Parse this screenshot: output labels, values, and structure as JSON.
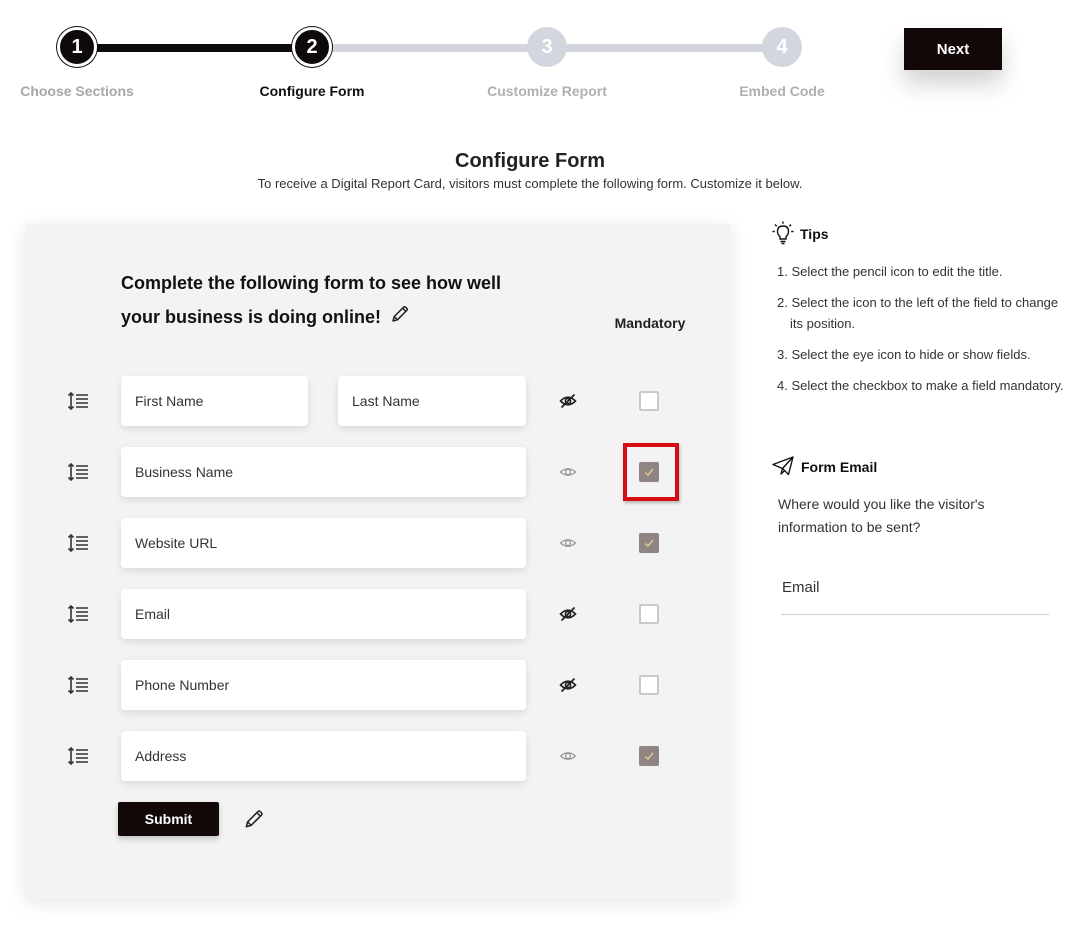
{
  "stepper": {
    "steps": [
      {
        "number": "1",
        "label": "Choose Sections"
      },
      {
        "number": "2",
        "label": "Configure Form"
      },
      {
        "number": "3",
        "label": "Customize Report"
      },
      {
        "number": "4",
        "label": "Embed Code"
      }
    ],
    "next_label": "Next"
  },
  "page": {
    "title": "Configure Form",
    "subtitle": "To receive a Digital Report Card, visitors must complete the following form. Customize it below."
  },
  "form": {
    "title": "Complete the following form to see how well your business is doing online!",
    "mandatory_label": "Mandatory",
    "fields": {
      "first_name": {
        "placeholder": "First Name"
      },
      "last_name": {
        "placeholder": "Last Name"
      },
      "business_name": {
        "placeholder": "Business Name"
      },
      "website_url": {
        "placeholder": "Website URL"
      },
      "email": {
        "placeholder": "Email"
      },
      "phone_number": {
        "placeholder": "Phone Number"
      },
      "address": {
        "placeholder": "Address"
      }
    },
    "rows_state": [
      {
        "visible": false,
        "mandatory": false
      },
      {
        "visible": true,
        "mandatory": true
      },
      {
        "visible": true,
        "mandatory": true
      },
      {
        "visible": false,
        "mandatory": false
      },
      {
        "visible": false,
        "mandatory": false
      },
      {
        "visible": true,
        "mandatory": true
      }
    ],
    "submit_label": "Submit"
  },
  "tips": {
    "heading": "Tips",
    "items": [
      "1. Select the pencil icon to edit the title.",
      "2. Select the icon to the left of the field to change its position.",
      "3. Select the eye icon to hide or show fields.",
      "4. Select the checkbox to make a field mandatory."
    ]
  },
  "form_email": {
    "heading": "Form Email",
    "question": "Where would you like the visitor's information to be sent?",
    "input_placeholder": "Email"
  },
  "colors": {
    "primary": "#120808",
    "inactive_step": "#d3d6de",
    "checked_box": "#8f8582",
    "highlight": "#d40f14"
  },
  "icons": [
    "drag-handle-icon",
    "eye-icon",
    "eye-slash-icon",
    "pencil-icon",
    "lightbulb-icon",
    "paper-plane-icon",
    "checkmark-icon"
  ]
}
